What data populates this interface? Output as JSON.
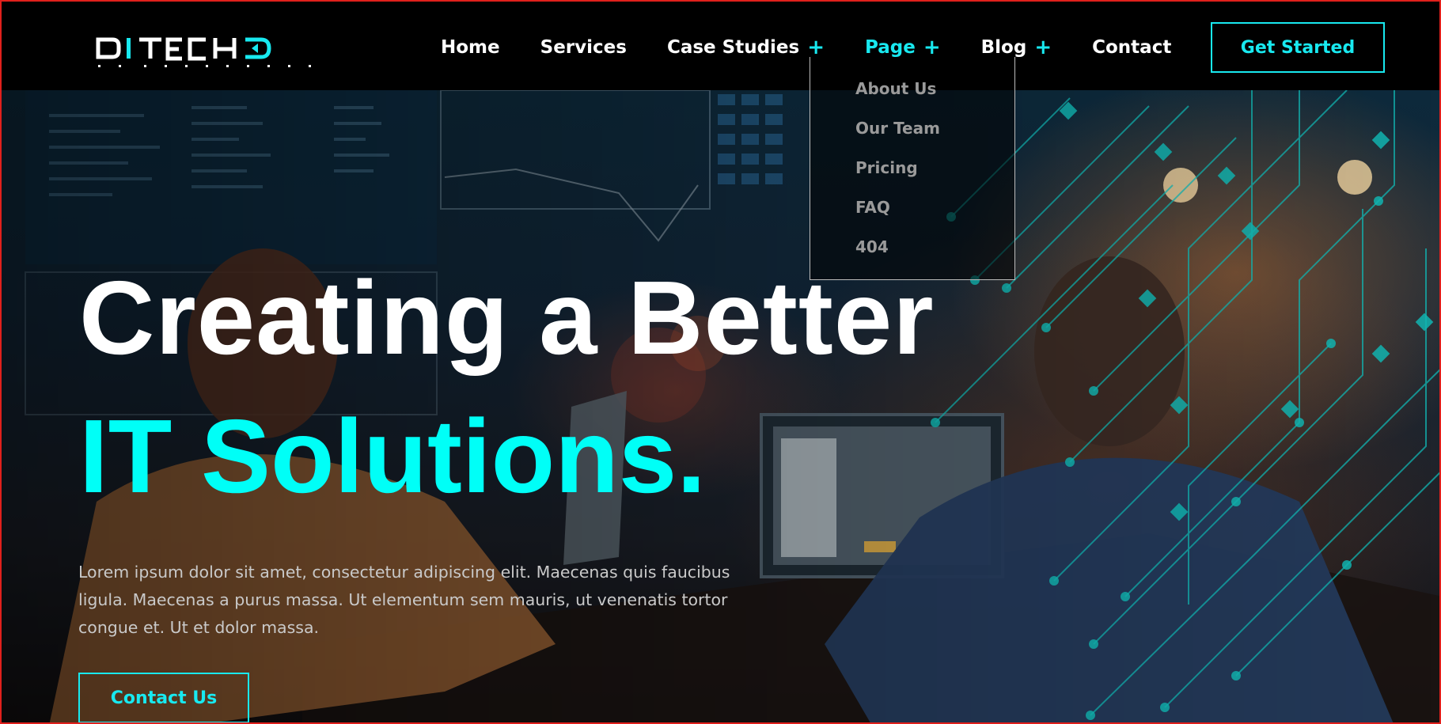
{
  "brand": {
    "name": "DITECH",
    "tagline": "IT SOLUTIONS",
    "accent_color": "#18e9f0",
    "border_color": "#e0201c"
  },
  "nav": {
    "items": [
      {
        "label": "Home",
        "has_submenu": false,
        "active": false
      },
      {
        "label": "Services",
        "has_submenu": false,
        "active": false
      },
      {
        "label": "Case Studies",
        "has_submenu": true,
        "active": false
      },
      {
        "label": "Page",
        "has_submenu": true,
        "active": true
      },
      {
        "label": "Blog",
        "has_submenu": true,
        "active": false
      },
      {
        "label": "Contact",
        "has_submenu": false,
        "active": false
      }
    ],
    "submenu_icon": "+",
    "cta_label": "Get Started"
  },
  "dropdown": {
    "items": [
      "About Us",
      "Our Team",
      "Pricing",
      "FAQ",
      "404"
    ]
  },
  "hero": {
    "title_line1": "Creating a Better",
    "title_line2": "IT Solutions.",
    "description": "Lorem ipsum dolor sit amet, consectetur adipiscing elit. Maecenas quis faucibus ligula. Maecenas a purus massa. Ut elementum sem mauris, ut venenatis tortor congue et. Ut et dolor massa.",
    "cta_label": "Contact Us",
    "background_icon": "office-photo-with-circuit-overlay"
  }
}
